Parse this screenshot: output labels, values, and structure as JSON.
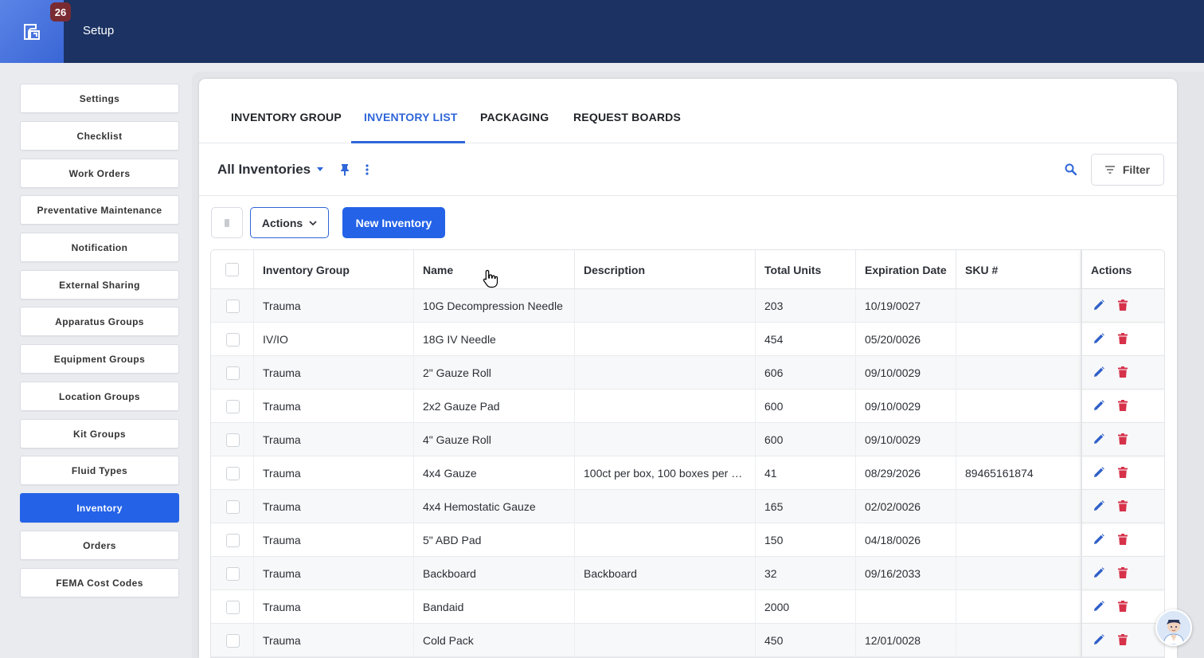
{
  "header": {
    "title": "Setup",
    "notification_count": "26",
    "logo_icon": "app-logo-icon"
  },
  "sidebar": {
    "items": [
      {
        "label": "Settings"
      },
      {
        "label": "Checklist"
      },
      {
        "label": "Work Orders"
      },
      {
        "label": "Preventative Maintenance"
      },
      {
        "label": "Notification"
      },
      {
        "label": "External Sharing"
      },
      {
        "label": "Apparatus Groups"
      },
      {
        "label": "Equipment Groups"
      },
      {
        "label": "Location Groups"
      },
      {
        "label": "Kit Groups"
      },
      {
        "label": "Fluid Types"
      },
      {
        "label": "Inventory"
      },
      {
        "label": "Orders"
      },
      {
        "label": "FEMA Cost Codes"
      }
    ],
    "active_index": 11
  },
  "tabs": [
    {
      "label": "INVENTORY GROUP"
    },
    {
      "label": "INVENTORY LIST"
    },
    {
      "label": "PACKAGING"
    },
    {
      "label": "REQUEST BOARDS"
    }
  ],
  "toolbar": {
    "view_title": "All Inventories",
    "filter_label": "Filter",
    "actions_label": "Actions",
    "new_label": "New Inventory"
  },
  "table": {
    "columns": [
      "Inventory Group",
      "Name",
      "Description",
      "Total Units",
      "Expiration Date",
      "SKU #",
      "Actions"
    ],
    "rows": [
      {
        "group": "Trauma",
        "name": "10G Decompression Needle",
        "description": "",
        "units": "203",
        "expiration": "10/19/0027",
        "sku": ""
      },
      {
        "group": "IV/IO",
        "name": "18G IV Needle",
        "description": "",
        "units": "454",
        "expiration": "05/20/0026",
        "sku": ""
      },
      {
        "group": "Trauma",
        "name": "2\" Gauze Roll",
        "description": "",
        "units": "606",
        "expiration": "09/10/0029",
        "sku": ""
      },
      {
        "group": "Trauma",
        "name": "2x2 Gauze Pad",
        "description": "",
        "units": "600",
        "expiration": "09/10/0029",
        "sku": ""
      },
      {
        "group": "Trauma",
        "name": "4\" Gauze Roll",
        "description": "",
        "units": "600",
        "expiration": "09/10/0029",
        "sku": ""
      },
      {
        "group": "Trauma",
        "name": "4x4 Gauze",
        "description": "100ct per box, 100 boxes per …",
        "units": "41",
        "expiration": "08/29/2026",
        "sku": "89465161874"
      },
      {
        "group": "Trauma",
        "name": "4x4 Hemostatic Gauze",
        "description": "",
        "units": "165",
        "expiration": "02/02/0026",
        "sku": ""
      },
      {
        "group": "Trauma",
        "name": "5\" ABD Pad",
        "description": "",
        "units": "150",
        "expiration": "04/18/0026",
        "sku": ""
      },
      {
        "group": "Trauma",
        "name": "Backboard",
        "description": "Backboard",
        "units": "32",
        "expiration": "09/16/2033",
        "sku": ""
      },
      {
        "group": "Trauma",
        "name": "Bandaid",
        "description": "",
        "units": "2000",
        "expiration": "",
        "sku": ""
      },
      {
        "group": "Trauma",
        "name": "Cold Pack",
        "description": "",
        "units": "450",
        "expiration": "12/01/0028",
        "sku": ""
      }
    ]
  },
  "colors": {
    "header_bg": "#1b3263",
    "accent": "#2463e8",
    "edit_icon": "#2f5fc9",
    "delete_icon": "#d6324a",
    "badge_bg": "#7a2b32"
  }
}
